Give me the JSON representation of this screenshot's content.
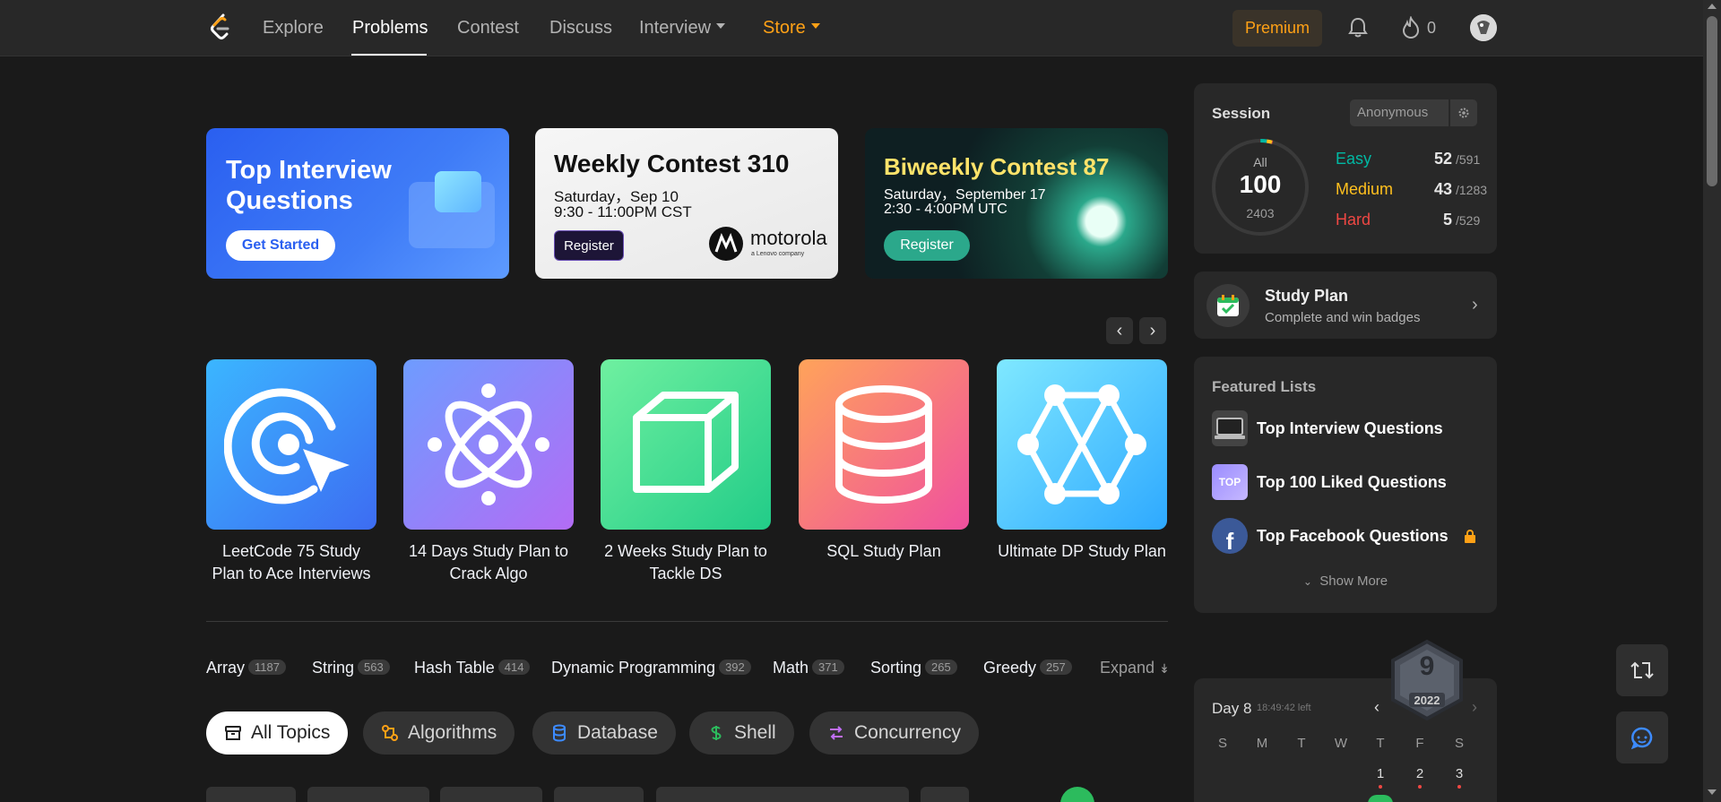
{
  "nav": {
    "items": [
      "Explore",
      "Problems",
      "Contest",
      "Discuss",
      "Interview",
      "Store"
    ],
    "premium": "Premium",
    "fire_count": "0"
  },
  "banners": {
    "top_interview": {
      "title": "Top Interview Questions",
      "button": "Get Started"
    },
    "weekly": {
      "title": "Weekly Contest 310",
      "date": "Saturday，Sep 10",
      "time": "9:30 - 11:00PM CST",
      "button": "Register",
      "sponsor": "motorola",
      "sponsor_sub": "a Lenovo company"
    },
    "biweekly": {
      "title": "Biweekly Contest 87",
      "date": "Saturday，September 17",
      "time": "2:30 - 4:00PM UTC",
      "button": "Register"
    }
  },
  "plans": [
    {
      "label": "LeetCode 75 Study Plan to Ace Interviews",
      "icon": "target-cursor-icon"
    },
    {
      "label": "14 Days Study Plan to Crack Algo",
      "icon": "atom-icon"
    },
    {
      "label": "2 Weeks Study Plan to Tackle DS",
      "icon": "cube-icon"
    },
    {
      "label": "SQL Study Plan",
      "icon": "database-icon"
    },
    {
      "label": "Ultimate DP Study Plan",
      "icon": "graph-icon"
    }
  ],
  "tags": [
    {
      "name": "Array",
      "count": "1187"
    },
    {
      "name": "String",
      "count": "563"
    },
    {
      "name": "Hash Table",
      "count": "414"
    },
    {
      "name": "Dynamic Programming",
      "count": "392"
    },
    {
      "name": "Math",
      "count": "371"
    },
    {
      "name": "Sorting",
      "count": "265"
    },
    {
      "name": "Greedy",
      "count": "257"
    }
  ],
  "expand": "Expand",
  "topics": [
    "All Topics",
    "Algorithms",
    "Database",
    "Shell",
    "Concurrency"
  ],
  "session": {
    "title": "Session",
    "user": "Anonymous",
    "all_label": "All",
    "solved": "100",
    "total": "2403",
    "easy": {
      "label": "Easy",
      "solved": "52",
      "total": "/591"
    },
    "medium": {
      "label": "Medium",
      "solved": "43",
      "total": "/1283"
    },
    "hard": {
      "label": "Hard",
      "solved": "5",
      "total": "/529"
    }
  },
  "study_plan": {
    "title": "Study Plan",
    "subtitle": "Complete and win badges"
  },
  "featured": {
    "title": "Featured Lists",
    "items": [
      "Top Interview Questions",
      "Top 100 Liked Questions",
      "Top Facebook Questions"
    ],
    "thumb_text": "TOP",
    "show_more": "Show More"
  },
  "calendar": {
    "day": "Day 8",
    "left": "18:49:42 left",
    "weekdays": [
      "S",
      "M",
      "T",
      "W",
      "T",
      "F",
      "S"
    ],
    "days": [
      "1",
      "2",
      "3"
    ],
    "badge_num": "9",
    "badge_year": "2022"
  },
  "colors": {
    "accent": "#ffa116",
    "easy": "#00b8a3",
    "medium": "#ffc01e",
    "hard": "#ef4743"
  }
}
